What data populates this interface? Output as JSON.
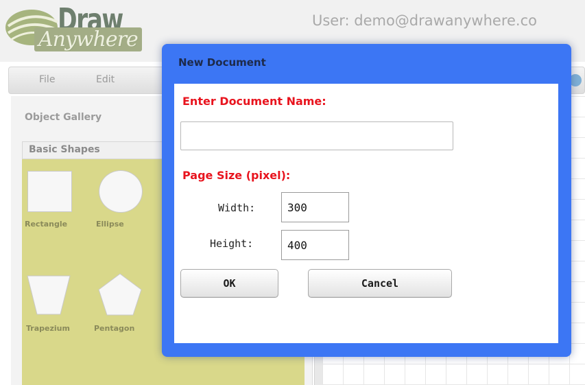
{
  "app": {
    "logo_text": "Draw",
    "logo_subtext": "Anywhere",
    "user_label": "User: demo@drawanywhere.co"
  },
  "menu": {
    "items": [
      {
        "label": "File"
      },
      {
        "label": "Edit"
      }
    ]
  },
  "sidebar": {
    "gallery_title": "Object Gallery",
    "category_tab": "Basic Shapes",
    "shapes": [
      {
        "label": "Rectangle"
      },
      {
        "label": "Ellipse"
      },
      {
        "label": "Trapezium"
      },
      {
        "label": "Pentagon"
      }
    ]
  },
  "dialog": {
    "title": "New Document",
    "name_label": "Enter Document Name:",
    "name_value": "",
    "size_label": "Page Size (pixel):",
    "width_label": "Width:",
    "width_value": "300",
    "height_label": "Height:",
    "height_value": "400",
    "ok_label": "OK",
    "cancel_label": "Cancel"
  },
  "colors": {
    "dialog_border": "#3c76f4",
    "label_red": "#e8141e",
    "shape_panel": "#d9d88a"
  }
}
